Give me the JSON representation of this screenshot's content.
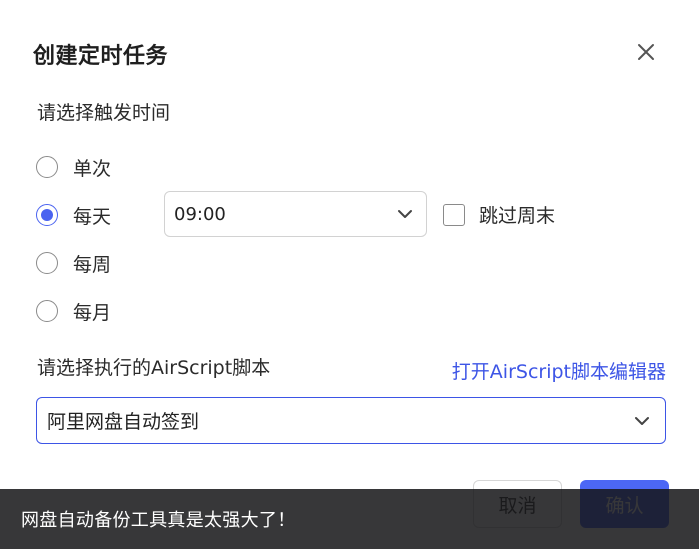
{
  "dialog": {
    "title": "创建定时任务",
    "close_icon": "close-icon"
  },
  "trigger": {
    "label": "请选择触发时间",
    "options": [
      {
        "label": "单次",
        "checked": false
      },
      {
        "label": "每天",
        "checked": true
      },
      {
        "label": "每周",
        "checked": false
      },
      {
        "label": "每月",
        "checked": false
      }
    ],
    "time_value": "09:00",
    "skip_weekend_label": "跳过周末",
    "skip_weekend_checked": false
  },
  "script": {
    "label": "请选择执行的AirScript脚本",
    "open_editor_link": "打开AirScript脚本编辑器",
    "selected": "阿里网盘自动签到"
  },
  "buttons": {
    "cancel": "取消",
    "confirm": "确认"
  },
  "toast": {
    "message": "网盘自动备份工具真是太强大了！"
  },
  "colors": {
    "accent": "#4a63f0",
    "link": "#3d55e6",
    "toast_bg": "#161618"
  }
}
